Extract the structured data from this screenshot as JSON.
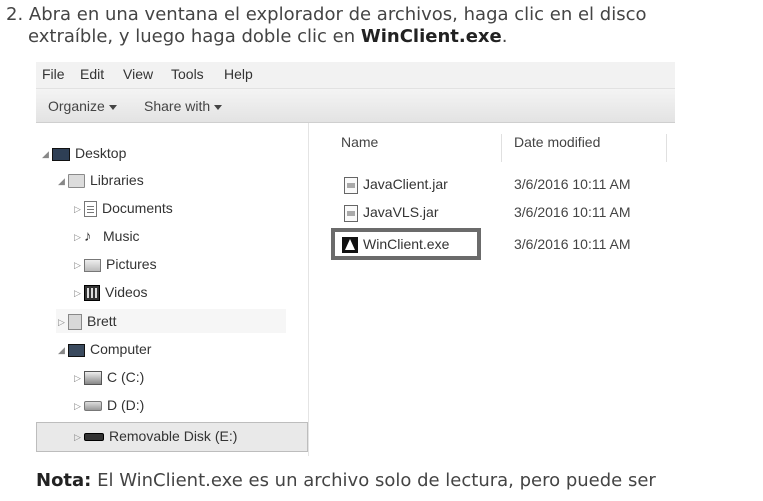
{
  "instructions": {
    "line1": "2. Abra en una ventana el explorador de archivos, haga clic en el disco",
    "line2_prefix": "extraíble, y luego haga doble clic en ",
    "line2_bold": "WinClient.exe",
    "line2_suffix": "."
  },
  "menubar": {
    "file": "File",
    "edit": "Edit",
    "view": "View",
    "tools": "Tools",
    "help": "Help"
  },
  "toolbar": {
    "organize": "Organize",
    "share_with": "Share with"
  },
  "tree": {
    "desktop": "Desktop",
    "libraries": "Libraries",
    "documents": "Documents",
    "music": "Music",
    "pictures": "Pictures",
    "videos": "Videos",
    "brett": "Brett",
    "computer": "Computer",
    "c_drive": "C (C:)",
    "d_drive": "D (D:)",
    "removable": "Removable Disk (E:)"
  },
  "columns": {
    "name": "Name",
    "date_modified": "Date modified"
  },
  "files": [
    {
      "name": "JavaClient.jar",
      "date": "3/6/2016 10:11 AM",
      "icon": "jar-file-icon"
    },
    {
      "name": "JavaVLS.jar",
      "date": "3/6/2016 10:11 AM",
      "icon": "jar-file-icon"
    },
    {
      "name": "WinClient.exe",
      "date": "3/6/2016 10:11 AM",
      "icon": "exe-app-icon"
    }
  ],
  "note": {
    "label": "Nota:",
    "text": " El WinClient.exe es un archivo solo de lectura, pero puede ser"
  }
}
